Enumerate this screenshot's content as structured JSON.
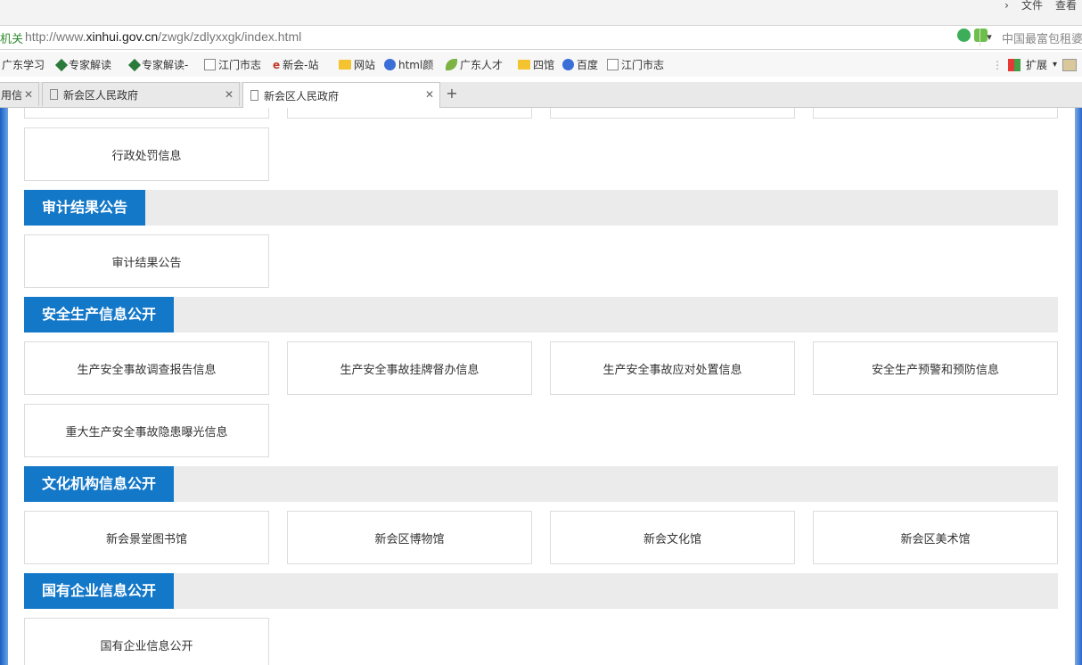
{
  "browser": {
    "top_menu": [
      "文件",
      "查看"
    ],
    "address": {
      "prefix": "机关",
      "url_scheme": "http://www.",
      "url_host": "xinhui.gov.cn",
      "url_path": "/zwgk/zdlyxxgk/index.html",
      "search_placeholder": "中国最富包租婆"
    },
    "bookmarks": [
      {
        "label": "广东学习",
        "icon": "none"
      },
      {
        "label": "专家解读",
        "icon": "diamond-icon"
      },
      {
        "label": "专家解读-",
        "icon": "diamond-icon"
      },
      {
        "label": "江门市志",
        "icon": "page-icon"
      },
      {
        "label": "新会-站",
        "icon": "e-icon"
      },
      {
        "label": "网站",
        "icon": "folder-icon"
      },
      {
        "label": "html颜",
        "icon": "paw-icon"
      },
      {
        "label": "广东人才",
        "icon": "leaf-icon"
      },
      {
        "label": "四馆",
        "icon": "folder-icon"
      },
      {
        "label": "百度",
        "icon": "paw-icon"
      },
      {
        "label": "江门市志",
        "icon": "page-icon"
      }
    ],
    "extensions_label": "扩展",
    "tabs": [
      {
        "label": "用信",
        "active": false
      },
      {
        "label": "新会区人民政府",
        "active": false
      },
      {
        "label": "新会区人民政府",
        "active": true
      }
    ]
  },
  "page": {
    "top_partial_card": "行政处罚信息",
    "sections": [
      {
        "heading": "审计结果公告",
        "cards": [
          "审计结果公告"
        ]
      },
      {
        "heading": "安全生产信息公开",
        "cards": [
          "生产安全事故调查报告信息",
          "生产安全事故挂牌督办信息",
          "生产安全事故应对处置信息",
          "安全生产预警和预防信息",
          "重大生产安全事故隐患曝光信息"
        ]
      },
      {
        "heading": "文化机构信息公开",
        "cards": [
          "新会景堂图书馆",
          "新会区博物馆",
          "新会文化馆",
          "新会区美术馆"
        ]
      },
      {
        "heading": "国有企业信息公开",
        "cards": [
          "国有企业信息公开"
        ]
      }
    ]
  },
  "colors": {
    "section_accent": "#1478c9",
    "section_band": "#ebebeb",
    "card_border": "#dcdcdc"
  }
}
